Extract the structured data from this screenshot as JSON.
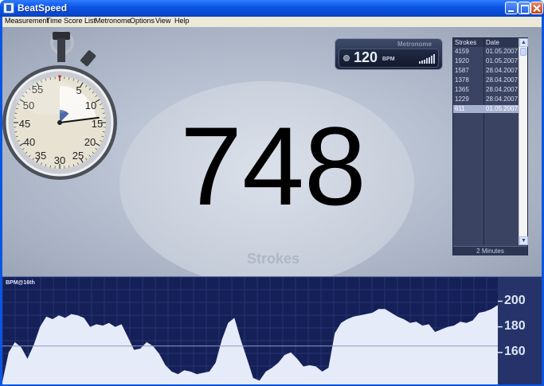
{
  "window": {
    "title": "BeatSpeed"
  },
  "menu": [
    "Measurement",
    "Time",
    "Score List",
    "Metronome",
    "Options",
    "View",
    "Help"
  ],
  "stopwatch": {
    "dial_numbers": [
      "55",
      "5",
      "50",
      "10",
      "45",
      "15",
      "40",
      "20",
      "35",
      "25",
      "30"
    ],
    "elapsed_fraction": 0.23
  },
  "counter": {
    "value": "748",
    "label": "Strokes"
  },
  "metronome": {
    "title": "Metronome",
    "bpm": "120",
    "unit": "BPM"
  },
  "scorelist": {
    "columns": [
      "Strokes",
      "Date"
    ],
    "rows": [
      {
        "strokes": "4159",
        "date": "01.05.2007"
      },
      {
        "strokes": "1920",
        "date": "01.05.2007"
      },
      {
        "strokes": "1587",
        "date": "28.04.2007"
      },
      {
        "strokes": "1378",
        "date": "28.04.2007"
      },
      {
        "strokes": "1365",
        "date": "28.04.2007"
      },
      {
        "strokes": "1229",
        "date": "28.04.2007"
      },
      {
        "strokes": "611",
        "date": "01.05.2007"
      }
    ],
    "selected_index": 6,
    "footer": "2 Minutes"
  },
  "graph": {
    "title": "BPM@16th",
    "y_ticks": [
      "200",
      "180",
      "160"
    ],
    "y_tick_values": [
      200,
      180,
      160
    ],
    "y_range": [
      135,
      214
    ],
    "series": [
      137,
      160,
      168,
      164,
      155,
      166,
      180,
      188,
      186,
      189,
      187,
      190,
      189,
      187,
      180,
      182,
      181,
      183,
      180,
      182,
      172,
      162,
      163,
      168,
      165,
      159,
      150,
      145,
      143,
      146,
      145,
      143,
      144,
      145,
      152,
      170,
      183,
      187,
      170,
      155,
      140,
      138,
      145,
      148,
      152,
      158,
      160,
      155,
      149,
      150,
      149,
      145,
      148,
      175,
      183,
      186,
      188,
      189,
      190,
      191,
      194,
      194,
      191,
      188,
      186,
      183,
      184,
      181,
      182,
      176,
      178,
      180,
      181,
      184,
      183,
      185,
      191,
      192,
      194,
      197
    ]
  }
}
